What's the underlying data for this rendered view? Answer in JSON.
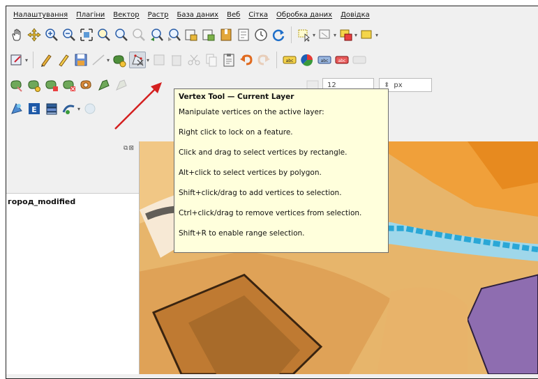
{
  "menu": {
    "items": [
      "Налаштування",
      "Плагіни",
      "Вектор",
      "Растр",
      "База даних",
      "Веб",
      "Сітка",
      "Обробка даних",
      "Довідка"
    ]
  },
  "toolbar": {
    "font_size_value": "12",
    "font_unit": "px"
  },
  "panel": {
    "layer_name": "город_modified"
  },
  "tooltip": {
    "title": "Vertex Tool — Current Layer",
    "lines": [
      "Manipulate vertices on the active layer:",
      "Right click to lock on a feature.",
      "Click and drag to select vertices by rectangle.",
      "Alt+click to select vertices by polygon.",
      "Shift+click/drag to add vertices to selection.",
      "Ctrl+click/drag to remove vertices from selection.",
      "Shift+R to enable range selection."
    ]
  },
  "colors": {
    "arrow": "#d42020",
    "tooltip_bg": "#ffffdc",
    "map_polygon": "#8e6db0"
  }
}
